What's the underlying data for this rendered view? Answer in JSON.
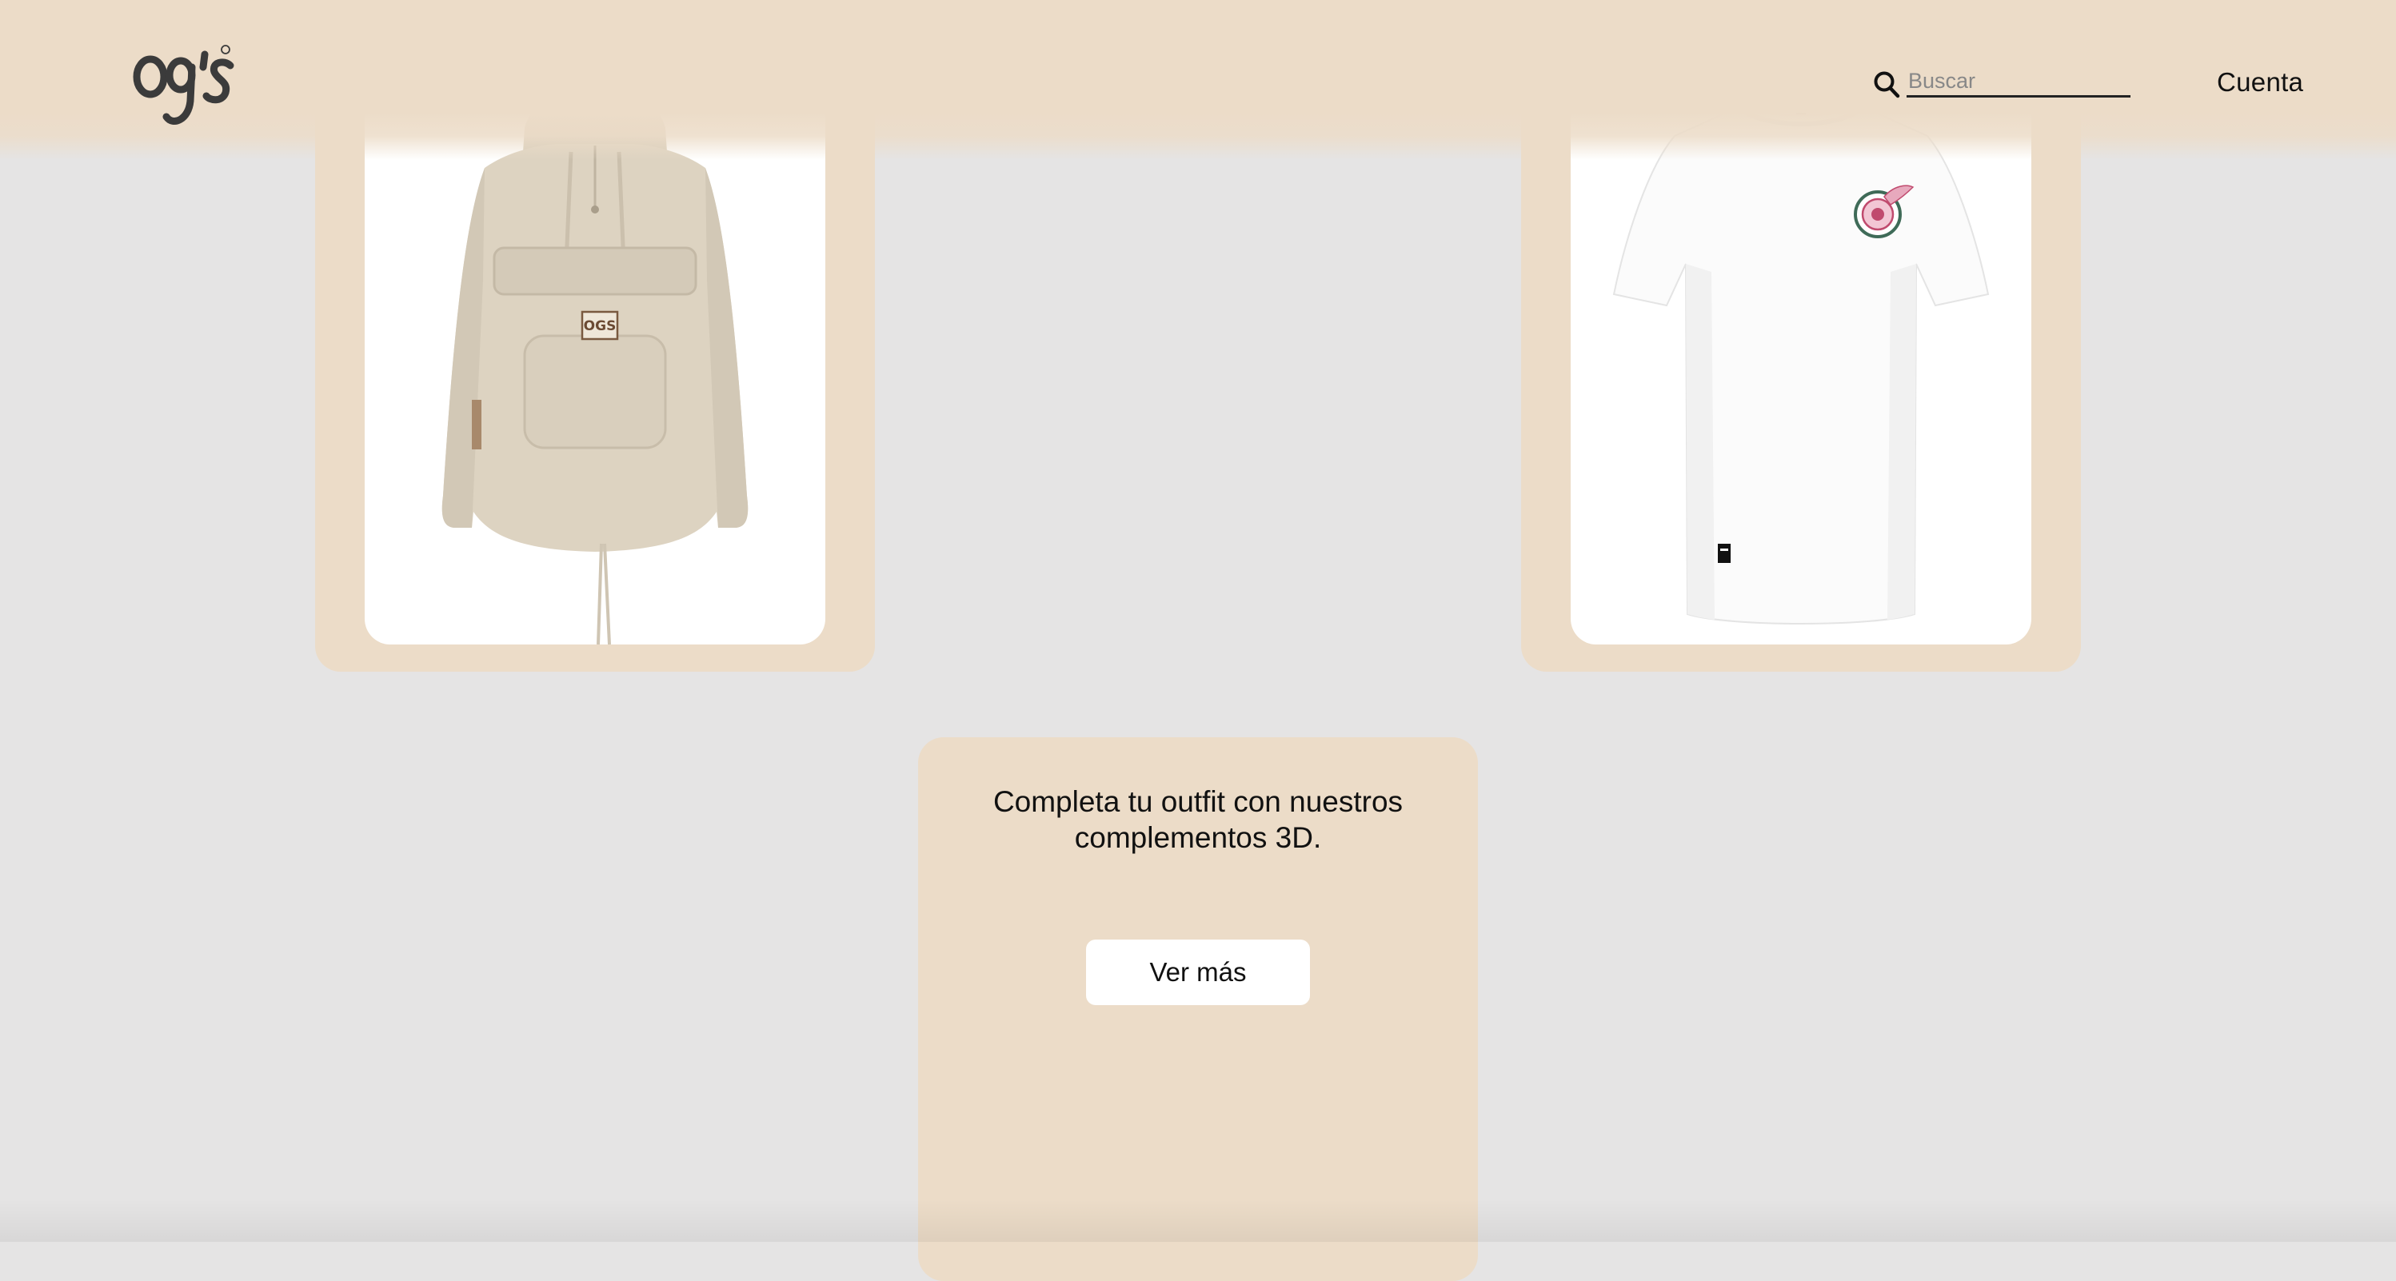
{
  "header": {
    "logo_text": "og's",
    "logo_icon": "brand-logo",
    "search": {
      "icon": "search-icon",
      "placeholder": "Buscar",
      "value": ""
    },
    "account_label": "Cuenta"
  },
  "products": [
    {
      "image_alt": "Sudadera con capucha beige",
      "image_icon": "hoodie-image",
      "patch_text": "OGS"
    },
    {
      "image_alt": "Camiseta blanca",
      "image_icon": "tshirt-image"
    }
  ],
  "promo": {
    "text": "Completa tu outfit con nuestros complementos 3D.",
    "button_label": "Ver más"
  },
  "colors": {
    "background": "#e5e4e4",
    "card": "#ecdcc8",
    "header": "#ecdcc8",
    "text": "#111111",
    "button": "#ffffff"
  }
}
